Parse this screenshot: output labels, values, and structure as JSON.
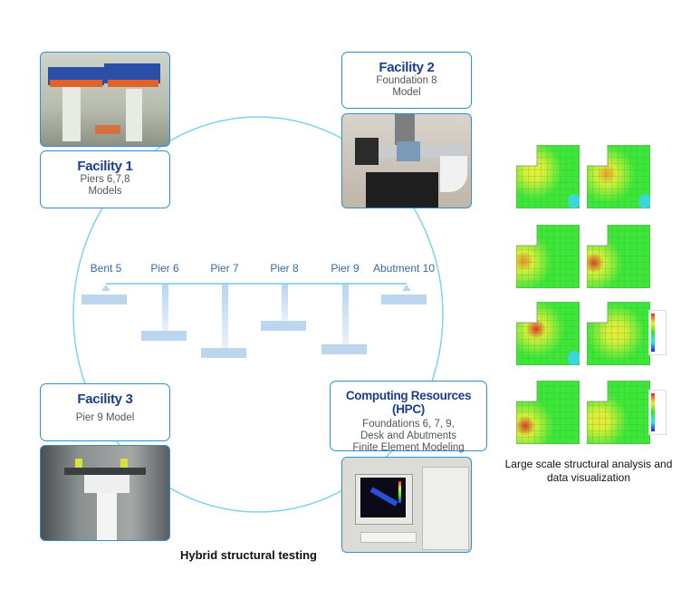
{
  "diagram": {
    "title": "Hybrid structural testing",
    "facilities": [
      {
        "id": "facility-1",
        "title": "Facility 1",
        "lines": [
          "Piers 6,7,8",
          "Models"
        ],
        "photo": "lab-test-frame-photo"
      },
      {
        "id": "facility-2",
        "title": "Facility 2",
        "lines": [
          "Foundation 8",
          "Model"
        ],
        "photo": "foundation-actuator-photo"
      },
      {
        "id": "facility-3",
        "title": "Facility 3",
        "lines": [
          "Pier 9 Model"
        ],
        "photo": "pier-test-rig-photo"
      },
      {
        "id": "hpc",
        "title": "Computing Resources (HPC)",
        "lines": [
          "Foundations 6, 7, 9,",
          "Desk and Abutments",
          "Finite Element Modeling"
        ],
        "photo": "computer-workstation-photo"
      }
    ],
    "bridge": {
      "supports": [
        "Bent 5",
        "Pier 6",
        "Pier 7",
        "Pier 8",
        "Pier 9",
        "Abutment 10"
      ]
    },
    "analysis": {
      "caption_line1": "Large scale structural analysis and",
      "caption_line2": "data visualization",
      "plots": 8
    },
    "colors": {
      "accent": "#2f8fd0",
      "circle": "#7fd3ee",
      "title": "#1a3f8a",
      "bridge": "#bcd6f0"
    }
  }
}
